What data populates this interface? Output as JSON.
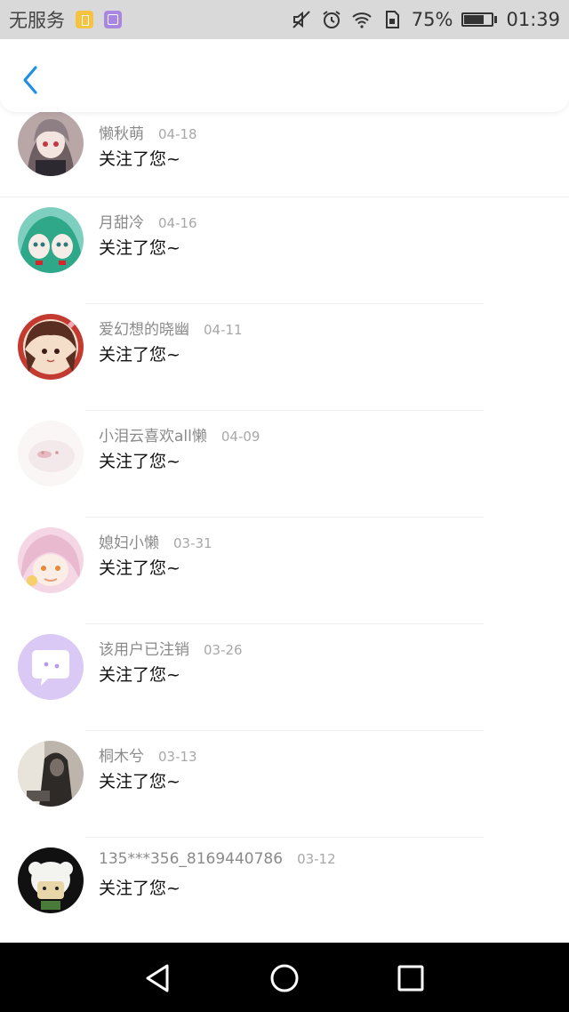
{
  "status_bar": {
    "carrier": "无服务",
    "battery_percent": "75%",
    "battery_level": 0.75,
    "time": "01:39",
    "icons": [
      "sim-app-icon",
      "gallery-app-icon",
      "mute-icon",
      "alarm-icon",
      "wifi-icon",
      "sim-card-icon",
      "battery-icon"
    ]
  },
  "nav": {
    "back_icon": "chevron-left-icon",
    "accent": "#1e90e6"
  },
  "notifications": [
    {
      "name": "懒秋萌",
      "date": "04-18",
      "message": "关注了您~",
      "avatar_color": "#6e5f63",
      "avatar": "anime-girl-gray-hair"
    },
    {
      "name": "月甜冷",
      "date": "04-16",
      "message": "关注了您~",
      "avatar_color": "#2fa889",
      "avatar": "anime-twins-green-hair"
    },
    {
      "name": "爱幻想的晓幽",
      "date": "04-11",
      "message": "关注了您~",
      "avatar_color": "#7a3a2a",
      "avatar": "anime-girl-brown-hair"
    },
    {
      "name": "小泪云喜欢all懒",
      "date": "04-09",
      "message": "关注了您~",
      "avatar_color": "#f3e8ea",
      "avatar": "white-creature"
    },
    {
      "name": "媳妇小懒",
      "date": "03-31",
      "message": "关注了您~",
      "avatar_color": "#e9b9cf",
      "avatar": "anime-pink-hair"
    },
    {
      "name": "该用户已注销",
      "date": "03-26",
      "message": "关注了您~",
      "avatar_color": "#b79ae9",
      "avatar": "default-chat-bubble"
    },
    {
      "name": "桐木兮",
      "date": "03-13",
      "message": "关注了您~",
      "avatar_color": "#4d4d4d",
      "avatar": "photo-dark"
    },
    {
      "name": "135***356_8169440786",
      "date": "03-12",
      "message": "关注了您~",
      "avatar_color": "#222222",
      "avatar": "sheep-cartoon"
    }
  ],
  "system_nav": {
    "back": "triangle-back-icon",
    "home": "circle-home-icon",
    "recents": "square-recents-icon"
  }
}
